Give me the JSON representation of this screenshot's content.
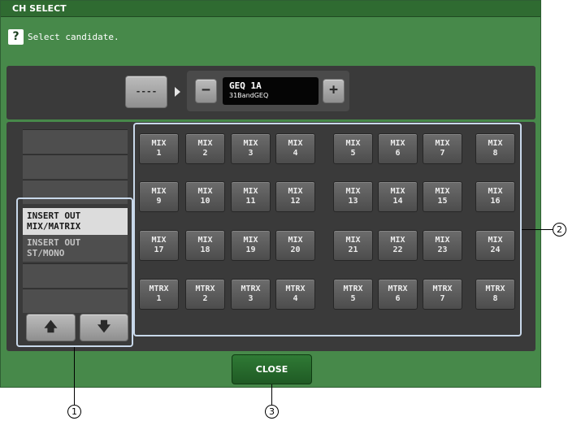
{
  "dialog": {
    "title": "CH SELECT",
    "help_icon": "?",
    "prompt": "Select candidate."
  },
  "top_panel": {
    "dash_button_label": "----",
    "minus_label": "−",
    "plus_label": "+",
    "geq_name": "GEQ 1A",
    "geq_type": "31BandGEQ"
  },
  "category_list": {
    "items": [
      {
        "label": "INSERT OUT\nMIX/MATRIX",
        "selected": true
      },
      {
        "label": "INSERT OUT\nST/MONO",
        "selected": false
      }
    ],
    "up_arrow": "🡅",
    "down_arrow": "🡇"
  },
  "channels": [
    {
      "line1": "MIX",
      "line2": "1"
    },
    {
      "line1": "MIX",
      "line2": "2"
    },
    {
      "line1": "MIX",
      "line2": "3"
    },
    {
      "line1": "MIX",
      "line2": "4"
    },
    {
      "line1": "MIX",
      "line2": "5"
    },
    {
      "line1": "MIX",
      "line2": "6"
    },
    {
      "line1": "MIX",
      "line2": "7"
    },
    {
      "line1": "MIX",
      "line2": "8"
    },
    {
      "line1": "MIX",
      "line2": "9"
    },
    {
      "line1": "MIX",
      "line2": "10"
    },
    {
      "line1": "MIX",
      "line2": "11"
    },
    {
      "line1": "MIX",
      "line2": "12"
    },
    {
      "line1": "MIX",
      "line2": "13"
    },
    {
      "line1": "MIX",
      "line2": "14"
    },
    {
      "line1": "MIX",
      "line2": "15"
    },
    {
      "line1": "MIX",
      "line2": "16"
    },
    {
      "line1": "MIX",
      "line2": "17"
    },
    {
      "line1": "MIX",
      "line2": "18"
    },
    {
      "line1": "MIX",
      "line2": "19"
    },
    {
      "line1": "MIX",
      "line2": "20"
    },
    {
      "line1": "MIX",
      "line2": "21"
    },
    {
      "line1": "MIX",
      "line2": "22"
    },
    {
      "line1": "MIX",
      "line2": "23"
    },
    {
      "line1": "MIX",
      "line2": "24"
    },
    {
      "line1": "MTRX",
      "line2": "1"
    },
    {
      "line1": "MTRX",
      "line2": "2"
    },
    {
      "line1": "MTRX",
      "line2": "3"
    },
    {
      "line1": "MTRX",
      "line2": "4"
    },
    {
      "line1": "MTRX",
      "line2": "5"
    },
    {
      "line1": "MTRX",
      "line2": "6"
    },
    {
      "line1": "MTRX",
      "line2": "7"
    },
    {
      "line1": "MTRX",
      "line2": "8"
    }
  ],
  "close_button_label": "CLOSE",
  "callouts": {
    "one": "1",
    "two": "2",
    "three": "3"
  }
}
